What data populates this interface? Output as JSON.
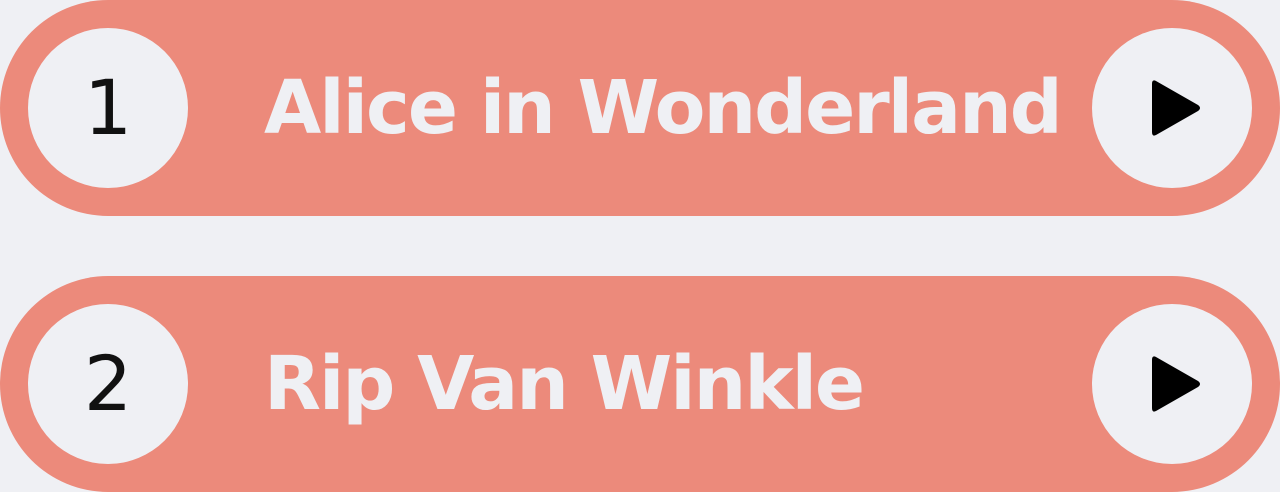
{
  "colors": {
    "background": "#eff0f4",
    "item_fill": "#ec8a7b",
    "number_text": "#111111",
    "title_text": "#eff0f4",
    "play_icon": "#000000"
  },
  "items": [
    {
      "number": "1",
      "title": "Alice in Wonderland",
      "action_icon": "play-icon"
    },
    {
      "number": "2",
      "title": "Rip Van Winkle",
      "action_icon": "play-icon"
    }
  ]
}
